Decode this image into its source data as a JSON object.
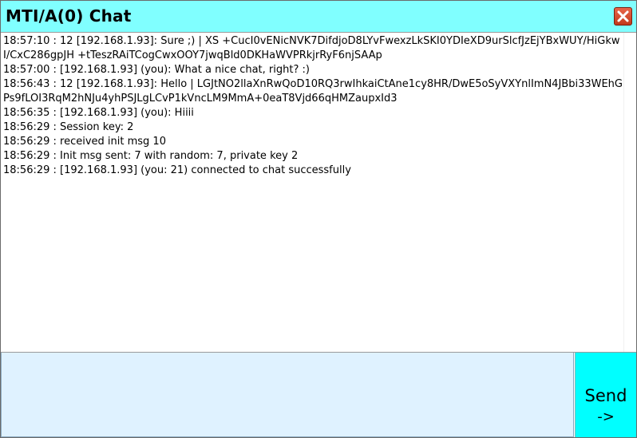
{
  "window": {
    "title": "MTI/A(0) Chat"
  },
  "chat_log": {
    "lines": [
      "18:57:10 : 12 [192.168.1.93]: Sure ;) | XS +CucI0vENicNVK7DifdjoD8LYvFwexzLkSKI0YDIeXD9urSlcfJzEjYBxWUY/HiGkwI/CxC286gpJH +tTeszRAiTCogCwxOOY7jwqBld0DKHaWVPRkjrRyF6njSAAp",
      "18:57:00 : [192.168.1.93] (you): What a nice chat, right? :)",
      "18:56:43 : 12 [192.168.1.93]: Hello | LGJtNO2llaXnRwQoD10RQ3rwIhkaiCtAne1cy8HR/DwE5oSyVXYnlImN4JBbi33WEhGPs9fLOI3RqM2hNJu4yhPSJLgLCvP1kVncLM9MmA+0eaT8Vjd66qHMZaupxId3",
      "18:56:35 : [192.168.1.93] (you): Hiiii",
      "18:56:29 : Session key: 2",
      "18:56:29 : received init msg 10",
      "18:56:29 : Init msg sent: 7 with random: 7, private key 2",
      "18:56:29 : [192.168.1.93] (you: 21) connected to chat successfully"
    ]
  },
  "composer": {
    "value": "",
    "send_label": "Send",
    "send_arrow": "->"
  },
  "colors": {
    "titlebar": "#80ffff",
    "send_button": "#00ffff",
    "input_background": "#dff2ff",
    "close_button": "#d64a2c"
  },
  "icons": {
    "close": "close-icon"
  }
}
